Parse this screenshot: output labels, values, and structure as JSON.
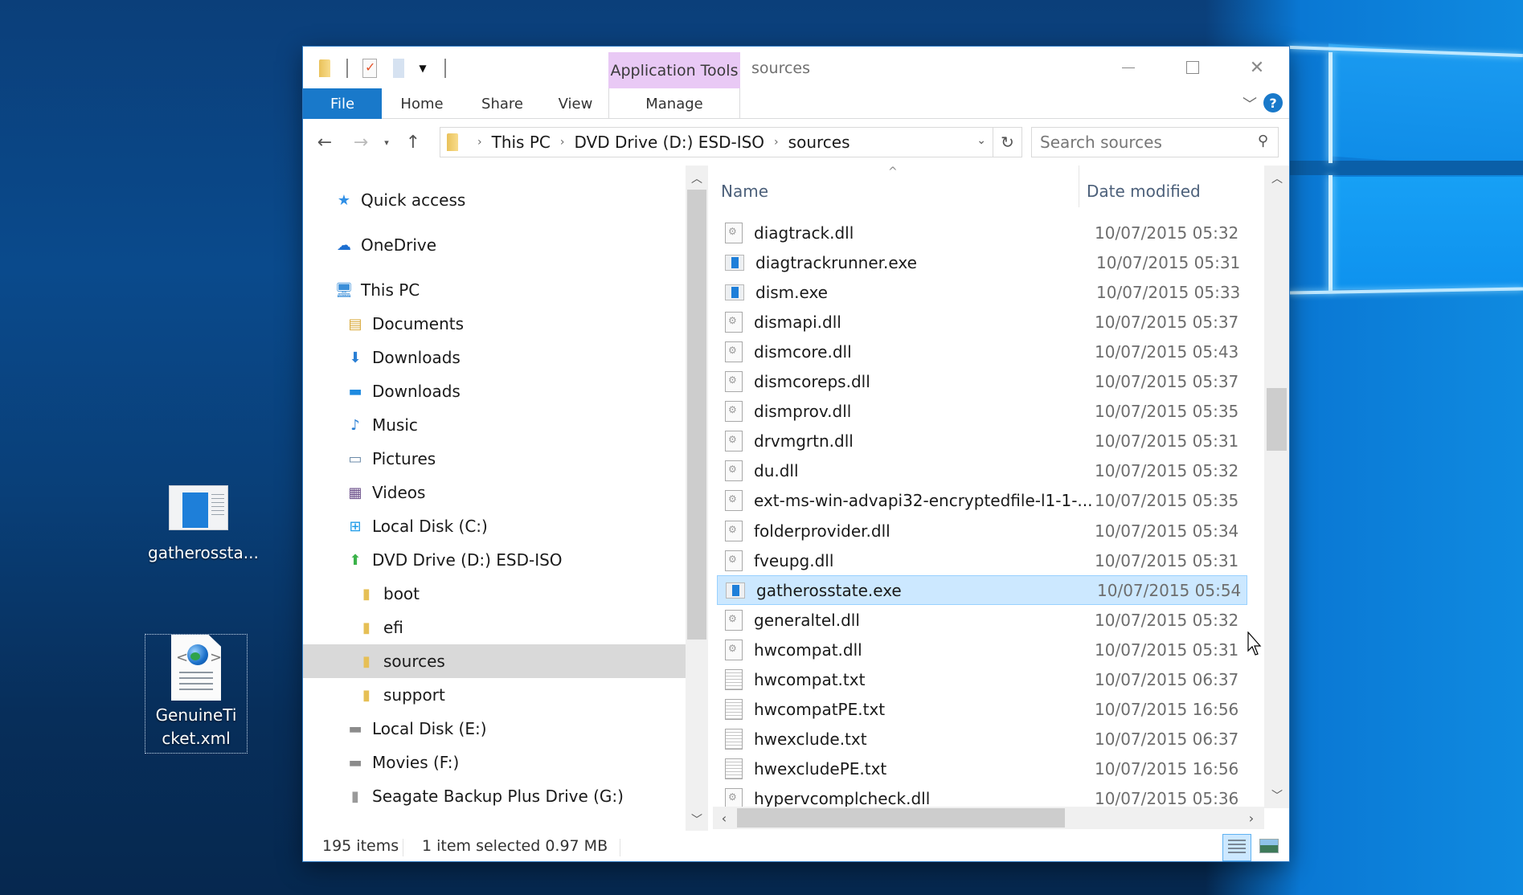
{
  "desktop": {
    "icons": [
      {
        "label": "gatherossta...",
        "type": "exe",
        "selected": false
      },
      {
        "label": "GenuineTicket.xml",
        "type": "xml",
        "selected": true
      }
    ]
  },
  "window": {
    "title": "sources",
    "contextual_tab_group": "Application Tools",
    "controls": {
      "minimize": "Minimize",
      "maximize": "Maximize",
      "close": "Close"
    },
    "quick_access_toolbar": [
      "folder-icon",
      "properties-icon",
      "new-folder-icon",
      "customize-dropdown-icon"
    ]
  },
  "ribbon": {
    "tabs": [
      {
        "label": "File",
        "active": true
      },
      {
        "label": "Home"
      },
      {
        "label": "Share"
      },
      {
        "label": "View"
      },
      {
        "label": "Manage"
      }
    ],
    "expand_icon": "chevron-down",
    "help_label": "?"
  },
  "navigation": {
    "back": "←",
    "forward": "→",
    "recent": "⌄",
    "up": "↑",
    "breadcrumb": [
      "This PC",
      "DVD Drive (D:) ESD-ISO",
      "sources"
    ],
    "refresh": "↻",
    "search_placeholder": "Search sources"
  },
  "nav_pane": {
    "items": [
      {
        "label": "Quick access",
        "icon": "star",
        "level": 0
      },
      {
        "label": "OneDrive",
        "icon": "cloud",
        "level": 0
      },
      {
        "label": "This PC",
        "icon": "computer",
        "level": 0
      },
      {
        "label": "Documents",
        "icon": "documents-folder",
        "level": 1
      },
      {
        "label": "Downloads",
        "icon": "downloads-folder",
        "level": 1
      },
      {
        "label": "Downloads",
        "icon": "desktop-folder",
        "level": 1
      },
      {
        "label": "Music",
        "icon": "music-folder",
        "level": 1
      },
      {
        "label": "Pictures",
        "icon": "pictures-folder",
        "level": 1
      },
      {
        "label": "Videos",
        "icon": "videos-folder",
        "level": 1
      },
      {
        "label": "Local Disk (C:)",
        "icon": "system-drive",
        "level": 1
      },
      {
        "label": "DVD Drive (D:) ESD-ISO",
        "icon": "dvd-drive",
        "level": 1
      },
      {
        "label": "boot",
        "icon": "folder",
        "level": 2
      },
      {
        "label": "efi",
        "icon": "folder",
        "level": 2
      },
      {
        "label": "sources",
        "icon": "folder",
        "level": 2,
        "selected": true
      },
      {
        "label": "support",
        "icon": "folder",
        "level": 2
      },
      {
        "label": "Local Disk (E:)",
        "icon": "drive",
        "level": 1
      },
      {
        "label": "Movies (F:)",
        "icon": "drive",
        "level": 1
      },
      {
        "label": "Seagate Backup Plus Drive (G:)",
        "icon": "external-drive",
        "level": 1
      }
    ]
  },
  "file_list": {
    "columns": [
      "Name",
      "Date modified"
    ],
    "sort_column": "Name",
    "rows": [
      {
        "name": "diagtrack.dll",
        "date": "10/07/2015 05:32",
        "type": "dll"
      },
      {
        "name": "diagtrackrunner.exe",
        "date": "10/07/2015 05:31",
        "type": "exe"
      },
      {
        "name": "dism.exe",
        "date": "10/07/2015 05:33",
        "type": "exe"
      },
      {
        "name": "dismapi.dll",
        "date": "10/07/2015 05:37",
        "type": "dll"
      },
      {
        "name": "dismcore.dll",
        "date": "10/07/2015 05:43",
        "type": "dll"
      },
      {
        "name": "dismcoreps.dll",
        "date": "10/07/2015 05:37",
        "type": "dll"
      },
      {
        "name": "dismprov.dll",
        "date": "10/07/2015 05:35",
        "type": "dll"
      },
      {
        "name": "drvmgrtn.dll",
        "date": "10/07/2015 05:31",
        "type": "dll"
      },
      {
        "name": "du.dll",
        "date": "10/07/2015 05:32",
        "type": "dll"
      },
      {
        "name": "ext-ms-win-advapi32-encryptedfile-l1-1-...",
        "date": "10/07/2015 05:35",
        "type": "dll"
      },
      {
        "name": "folderprovider.dll",
        "date": "10/07/2015 05:34",
        "type": "dll"
      },
      {
        "name": "fveupg.dll",
        "date": "10/07/2015 05:31",
        "type": "dll"
      },
      {
        "name": "gatherosstate.exe",
        "date": "10/07/2015 05:54",
        "type": "exe",
        "selected": true
      },
      {
        "name": "generaltel.dll",
        "date": "10/07/2015 05:32",
        "type": "dll"
      },
      {
        "name": "hwcompat.dll",
        "date": "10/07/2015 05:31",
        "type": "dll"
      },
      {
        "name": "hwcompat.txt",
        "date": "10/07/2015 06:37",
        "type": "txt"
      },
      {
        "name": "hwcompatPE.txt",
        "date": "10/07/2015 16:56",
        "type": "txt"
      },
      {
        "name": "hwexclude.txt",
        "date": "10/07/2015 06:37",
        "type": "txt"
      },
      {
        "name": "hwexcludePE.txt",
        "date": "10/07/2015 16:56",
        "type": "txt"
      },
      {
        "name": "hypervcomplcheck.dll",
        "date": "10/07/2015 05:36",
        "type": "dll"
      }
    ]
  },
  "status_bar": {
    "item_count": "195 items",
    "selection": "1 item selected  0.97 MB"
  },
  "colors": {
    "accent": "#1979ca",
    "contextual_tab": "#e9c9f5",
    "selection": "#cce8ff",
    "nav_selected": "#d9d9d9"
  }
}
